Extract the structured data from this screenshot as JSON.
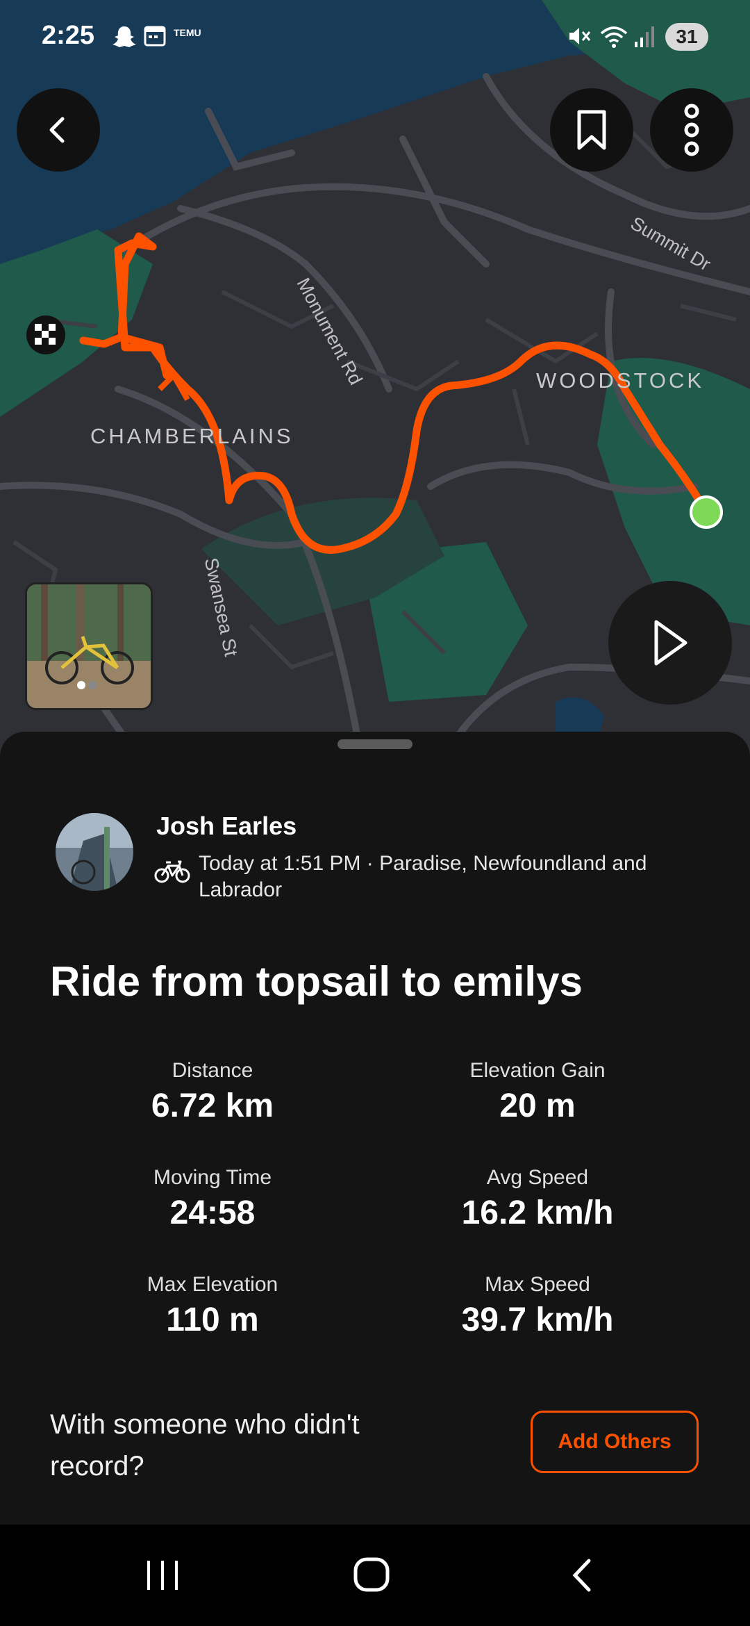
{
  "status_bar": {
    "time": "2:25",
    "battery": "31",
    "app_icon_text": "TEMU"
  },
  "map": {
    "labels": {
      "chamberlains": "CHAMBERLAINS",
      "woodstock": "WOODSTOCK"
    },
    "streets": {
      "monument": "Monument Rd",
      "swansea": "Swansea St",
      "summit": "Summit Dr"
    },
    "colors": {
      "route": "#fc5200",
      "start_marker": "#7ed957",
      "water": "#173a57",
      "park": "#1f5a4a",
      "land": "#2e3036"
    }
  },
  "activity": {
    "athlete_name": "Josh Earles",
    "meta": "Today at 1:51 PM · Paradise, Newfoundland and Labrador",
    "title": "Ride from topsail to emilys",
    "stats": {
      "distance": {
        "label": "Distance",
        "value": "6.72 km"
      },
      "elevation_gain": {
        "label": "Elevation Gain",
        "value": "20 m"
      },
      "moving_time": {
        "label": "Moving Time",
        "value": "24:58"
      },
      "avg_speed": {
        "label": "Avg Speed",
        "value": "16.2 km/h"
      },
      "max_elevation": {
        "label": "Max Elevation",
        "value": "110 m"
      },
      "max_speed": {
        "label": "Max Speed",
        "value": "39.7 km/h"
      }
    },
    "with_others_prompt": "With someone who didn't record?",
    "add_others_label": "Add Others"
  },
  "icons": [
    "back-icon",
    "bookmark-icon",
    "more-vertical-icon",
    "play-icon",
    "bike-icon",
    "finish-flag-icon",
    "recents-icon",
    "home-icon",
    "nav-back-icon"
  ]
}
